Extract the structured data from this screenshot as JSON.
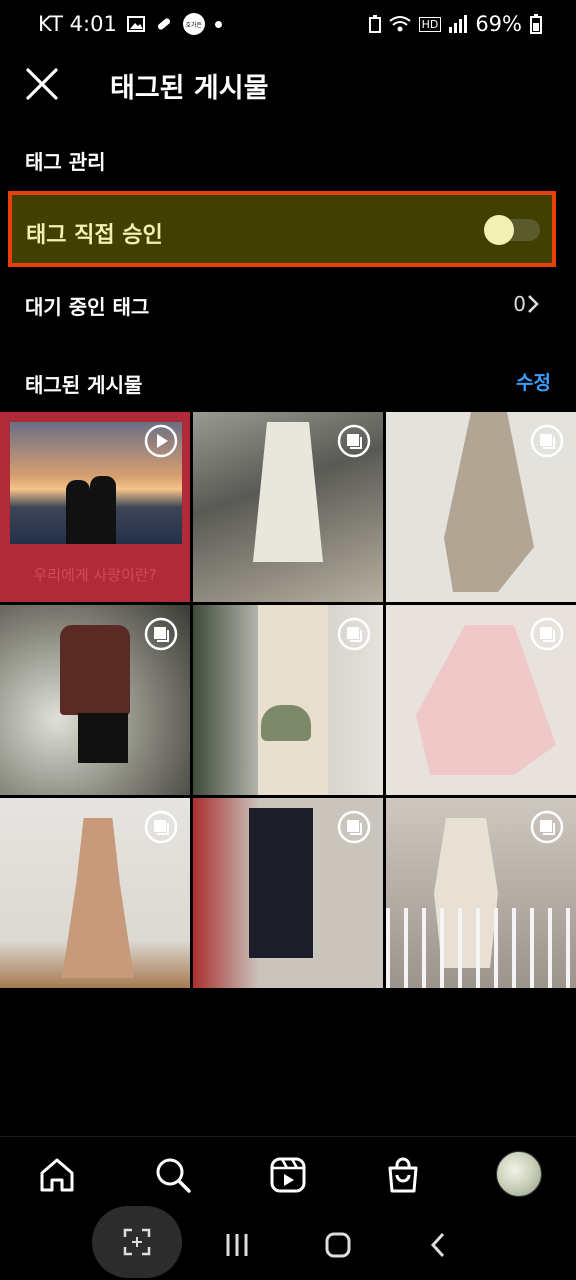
{
  "status": {
    "carrier_time": "KT 4:01",
    "badge_text": "호가든",
    "battery": "69%",
    "hd_label": "HD"
  },
  "header": {
    "title": "태그된 게시물"
  },
  "tag_manage": {
    "section_label": "태그 관리",
    "approve_label": "태그 직접 승인",
    "approve_on": false,
    "pending_label": "대기 중인 태그",
    "pending_count": "0"
  },
  "tagged_posts": {
    "section_label": "태그된 게시물",
    "edit_label": "수정",
    "first_post_caption": "우리에게 사랑이란?"
  },
  "colors": {
    "highlight_bg": "#414000",
    "highlight_border": "#e8400c",
    "link": "#3aa0ff"
  },
  "icons": {
    "close": "close-icon",
    "home": "home-icon",
    "search": "search-icon",
    "reels": "reels-icon",
    "shop": "shop-icon",
    "video": "video-play-icon",
    "multi": "multiple-photos-icon"
  }
}
